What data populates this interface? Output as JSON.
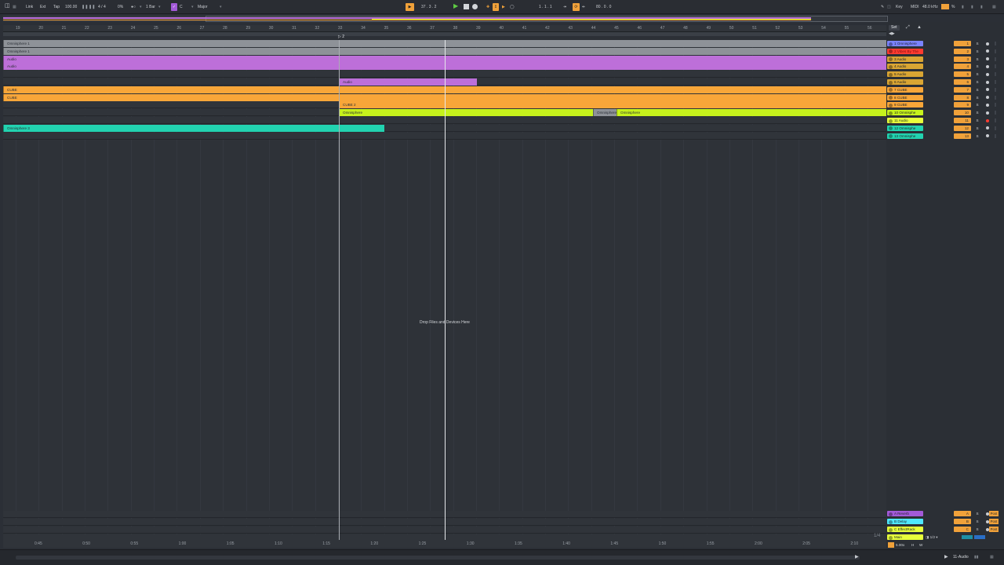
{
  "control_bar": {
    "link": "Link",
    "ext": "Ext",
    "tap": "Tap",
    "tempo": "100.00",
    "time_signature": "4 / 4",
    "groove": "0%",
    "quantize": "1 Bar",
    "key_root": "C",
    "scale": "Major",
    "position": "37 . 3 . 2",
    "loop_start": "1 . 1 . 1",
    "loop_length": "80 . 0 . 0",
    "key_label": "Key",
    "midi_label": "MIDI",
    "sample_rate": "48.0 kHz",
    "cpu": "%",
    "icons": [
      "browser-toggle-icon",
      "metronome-icon",
      "play-icon",
      "stop-icon",
      "record-icon",
      "loop-icon",
      "pencil-icon"
    ],
    "colors": {
      "accent": "#f0a13a",
      "play": "#5ecb43",
      "scale": "#a35ad8"
    }
  },
  "ruler": {
    "bars": [
      "19",
      "20",
      "21",
      "22",
      "23",
      "24",
      "25",
      "26",
      "27",
      "28",
      "29",
      "30",
      "31",
      "32",
      "33",
      "34",
      "35",
      "36",
      "37",
      "38",
      "39",
      "40",
      "41",
      "42",
      "43",
      "44",
      "45",
      "46",
      "47",
      "48",
      "49",
      "50",
      "51",
      "52",
      "53",
      "54",
      "55",
      "56"
    ],
    "locator": "2"
  },
  "clips": [
    {
      "lane": 0,
      "label": "Omnisphere 1",
      "color": "#8e9298"
    },
    {
      "lane": 1,
      "label": "Omnisphere 1",
      "color": "#8e9298"
    },
    {
      "lane": 2,
      "label": "Audio",
      "color": "#bd6fd9"
    },
    {
      "lane": 3,
      "label": "Audio",
      "color": "#bd6fd9"
    },
    {
      "lane": 5,
      "label": "Audio",
      "color": "#bd6fd9"
    },
    {
      "lane": 6,
      "label": "CUBE",
      "color": "#f8a639"
    },
    {
      "lane": 7,
      "label": "CUBE",
      "color": "#f8a639"
    },
    {
      "lane": 8,
      "label": "CUBE 2",
      "color": "#f8a639"
    },
    {
      "lane": 9,
      "label": "Omnisphere",
      "color": "#c6f21c"
    },
    {
      "lane": 9,
      "label": "Omnisphere",
      "color": "#8e9298"
    },
    {
      "lane": 9,
      "label": "Omnisphere",
      "color": "#c6f21c"
    },
    {
      "lane": 11,
      "label": "Omnisphere 3",
      "color": "#22d3b0"
    }
  ],
  "arrangement": {
    "drop_hint": "Drop Files and Devices Here"
  },
  "time_ruler": [
    "0:45",
    "0:50",
    "0:55",
    "1:00",
    "1:05",
    "1:10",
    "1:15",
    "1:20",
    "1:25",
    "1:30",
    "1:35",
    "1:40",
    "1:45",
    "1:50",
    "1:55",
    "2:00",
    "2:05",
    "2:10"
  ],
  "zoom_ratio": "1/4",
  "mixer": {
    "set_label": "Set",
    "tracks": [
      {
        "name": "1 Omnisphere",
        "color": "#7b83ff",
        "num": "1"
      },
      {
        "name": "2 Vibes By The",
        "color": "#ff3b30",
        "num": "2"
      },
      {
        "name": "3 Audio",
        "color": "#d9a533",
        "num": "3"
      },
      {
        "name": "4 Audio",
        "color": "#d9a533",
        "num": "4"
      },
      {
        "name": "5 Audio",
        "color": "#d9a533",
        "num": "5"
      },
      {
        "name": "6 Audio",
        "color": "#d9a533",
        "num": "6"
      },
      {
        "name": "7 CUBE",
        "color": "#f8a639",
        "num": "7"
      },
      {
        "name": "8 CUBE",
        "color": "#f8a639",
        "num": "8"
      },
      {
        "name": "9 CUBE",
        "color": "#f8a639",
        "num": "9"
      },
      {
        "name": "10 Omnisphe",
        "color": "#c6f21c",
        "num": "10"
      },
      {
        "name": "11 Audio",
        "color": "#e7ff3b",
        "num": "11"
      },
      {
        "name": "12 Omnisphe",
        "color": "#22d3b0",
        "num": "12"
      },
      {
        "name": "13 Omnisphe",
        "color": "#22d3b0",
        "num": "13"
      }
    ],
    "returns": [
      {
        "name": "A Reverb",
        "color": "#a35ad8",
        "num": "A"
      },
      {
        "name": "B Delay",
        "color": "#4fe8ff",
        "num": "B"
      },
      {
        "name": "C EffectRack",
        "color": "#e7ff3b",
        "num": "C"
      }
    ],
    "main": {
      "name": "Main",
      "color": "#e7ff3b",
      "cue": "1/2"
    },
    "post_label": "Post",
    "solo_label": "S",
    "footer": {
      "zoom": "5.00x",
      "h": "H",
      "w": "W"
    }
  },
  "status_bar": {
    "selected_track": "11-Audio"
  }
}
